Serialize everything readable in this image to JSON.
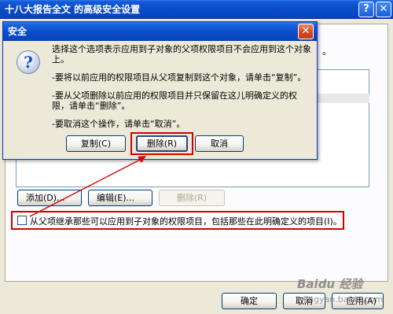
{
  "background_window": {
    "title": "十八大报告全文 的高级安全设置",
    "help_button": "?",
    "close_button": "✕",
    "dots": "。",
    "add_button": "添加(D)...",
    "edit_button": "编辑(E)...",
    "remove_button": "删除(R)",
    "inherit_checkbox_label": "从父项继承那些可以应用到子对象的权限项目，包括那些在此明确定义的项目(I)。",
    "inherit_checked": false,
    "ok_button": "确定",
    "cancel_button": "取消",
    "apply_button": "应用(A)"
  },
  "dialog": {
    "title": "安全",
    "close_button": "✕",
    "icon": "question-icon",
    "icon_glyph": "?",
    "message_1": "选择这个选项表示应用到子对象的父项权限项目不会应用到这个对象上。",
    "message_2": "-要将以前应用的权限项目从父项复制到这个对象，请单击“复制”。",
    "message_3": "-要从父项删除以前应用的权限项目并只保留在这儿明确定义的权限，请单击“删除”。",
    "message_4": "-要取消这个操作，请单击“取消”。",
    "copy_button": "复制(C)",
    "delete_button": "删除(R)",
    "cancel_button": "取消"
  },
  "annotation": {
    "highlight_color": "#d40000"
  },
  "watermark": {
    "title": "Baidu 经验",
    "url": "jingyan.baidu.com"
  }
}
